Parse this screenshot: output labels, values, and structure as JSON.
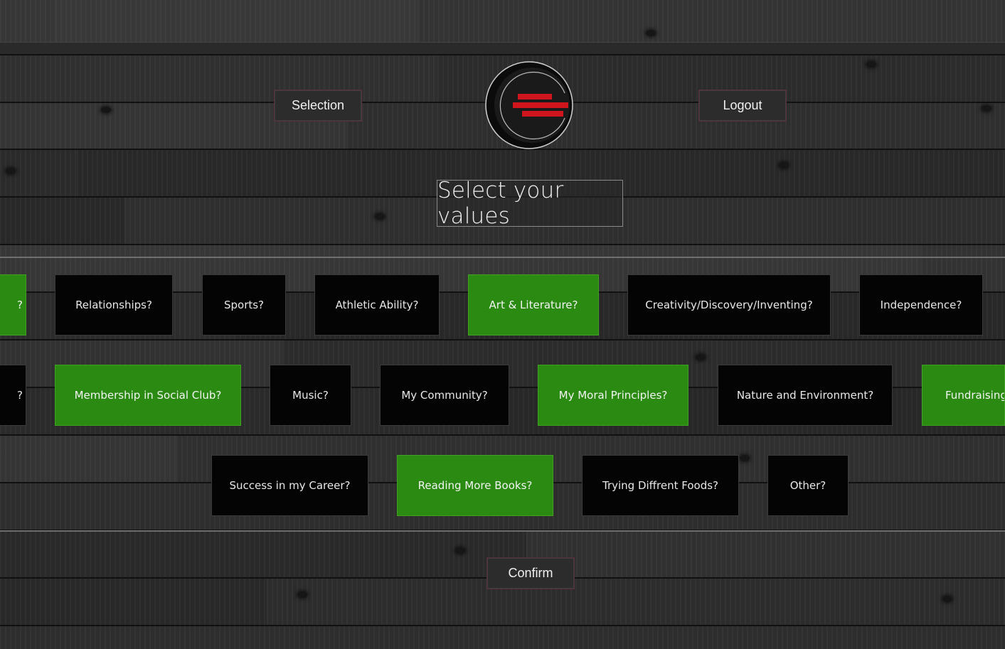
{
  "nav": {
    "selection_label": "Selection",
    "logout_label": "Logout"
  },
  "page_title": "Select your values",
  "values": {
    "row1": [
      {
        "label": "?",
        "selected": true
      },
      {
        "label": "Relationships?",
        "selected": false
      },
      {
        "label": "Sports?",
        "selected": false
      },
      {
        "label": "Athletic Ability?",
        "selected": false
      },
      {
        "label": "Art & Literature?",
        "selected": true
      },
      {
        "label": "Creativity/Discovery/Inventing?",
        "selected": false
      },
      {
        "label": "Independence?",
        "selected": false
      }
    ],
    "row2": [
      {
        "label": "?",
        "selected": false
      },
      {
        "label": "Membership in Social Club?",
        "selected": true
      },
      {
        "label": "Music?",
        "selected": false
      },
      {
        "label": "My Community?",
        "selected": false
      },
      {
        "label": "My Moral Principles?",
        "selected": true
      },
      {
        "label": "Nature and Environment?",
        "selected": false
      },
      {
        "label": "Fundraising?",
        "selected": true
      }
    ],
    "row3": [
      {
        "label": "Success in my Career?",
        "selected": false
      },
      {
        "label": "Reading More Books?",
        "selected": true
      },
      {
        "label": "Trying Diffrent Foods?",
        "selected": false
      },
      {
        "label": "Other?",
        "selected": false
      }
    ]
  },
  "confirm_label": "Confirm",
  "colors": {
    "selected_tile": "#2a8a12",
    "unselected_tile": "#040404",
    "logo_accent": "#d0161c"
  },
  "icons": {
    "logo": "crescent-bars-logo"
  }
}
